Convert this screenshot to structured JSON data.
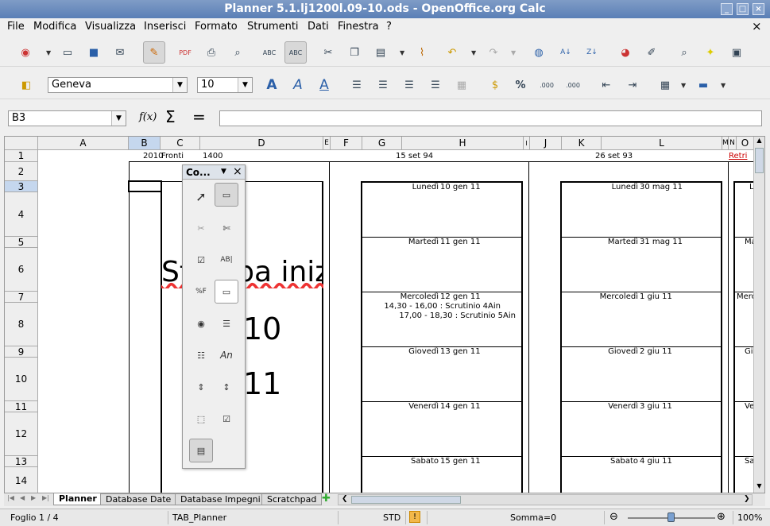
{
  "window": {
    "title": "Planner 5.1.lj1200l.09-10.ods - OpenOffice.org Calc",
    "buttons": [
      "_",
      "□",
      "×"
    ]
  },
  "menu": [
    "File",
    "Modifica",
    "Visualizza",
    "Inserisci",
    "Formato",
    "Strumenti",
    "Dati",
    "Finestra",
    "?"
  ],
  "format": {
    "font": "Geneva",
    "size": "10",
    "percent": "%",
    "dec1": ".000",
    "dec2": ".000"
  },
  "formula": {
    "cellref": "B3",
    "fx": "f(x)",
    "sigma": "Σ",
    "equals": "=",
    "content": ""
  },
  "columns": [
    "A",
    "B",
    "C",
    "D",
    "E",
    "F",
    "G",
    "H",
    "I",
    "J",
    "K",
    "L",
    "M",
    "N",
    "O"
  ],
  "rows": [
    "1",
    "2",
    "3",
    "4",
    "5",
    "6",
    "7",
    "8",
    "9",
    "10",
    "11",
    "12",
    "13",
    "14"
  ],
  "row1": {
    "b": "2010",
    "c": "Fronti",
    "c2": "1400",
    "h": "15 set 94",
    "l": "26 set 93",
    "n": "Retri"
  },
  "bigtext": {
    "line1": "Stampa inizer",
    "line2": "10",
    "line3": "11"
  },
  "week1": [
    {
      "day": "Lunedì",
      "date": "10 gen 11",
      "events": []
    },
    {
      "day": "Martedì",
      "date": "11 gen 11",
      "events": []
    },
    {
      "day": "Mercoledì",
      "date": "12 gen 11",
      "events": [
        "14,30 - 16,00 : Scrutinio 4Ain",
        "17,00 - 18,30 : Scrutinio 5Ain"
      ]
    },
    {
      "day": "Giovedì",
      "date": "13 gen 11",
      "events": []
    },
    {
      "day": "Venerdì",
      "date": "14 gen 11",
      "events": []
    },
    {
      "day": "Sabato",
      "date": "15 gen 11",
      "events": []
    }
  ],
  "week2": [
    {
      "day": "Lunedì",
      "date": "30 mag 11"
    },
    {
      "day": "Martedì",
      "date": "31 mag 11"
    },
    {
      "day": "Mercoledì",
      "date": "1 giu 11"
    },
    {
      "day": "Giovedì",
      "date": "2 giu 11"
    },
    {
      "day": "Venerdì",
      "date": "3 giu 11"
    },
    {
      "day": "Sabato",
      "date": "4 giu 11"
    }
  ],
  "week3": [
    "L",
    "Ma",
    "Merc",
    "Gi",
    "Ve",
    "Sa"
  ],
  "controls": {
    "title": "Co...",
    "close": "×",
    "abc": "ABC",
    "pctf": "%F",
    "an": "An"
  },
  "sheets": [
    "Planner",
    "Database Date",
    "Database Impegni",
    "Scratchpad"
  ],
  "status": {
    "sheet": "Foglio 1 / 4",
    "style": "TAB_Planner",
    "mode": "STD",
    "sum": "Somma=0",
    "zoom": "100%"
  }
}
